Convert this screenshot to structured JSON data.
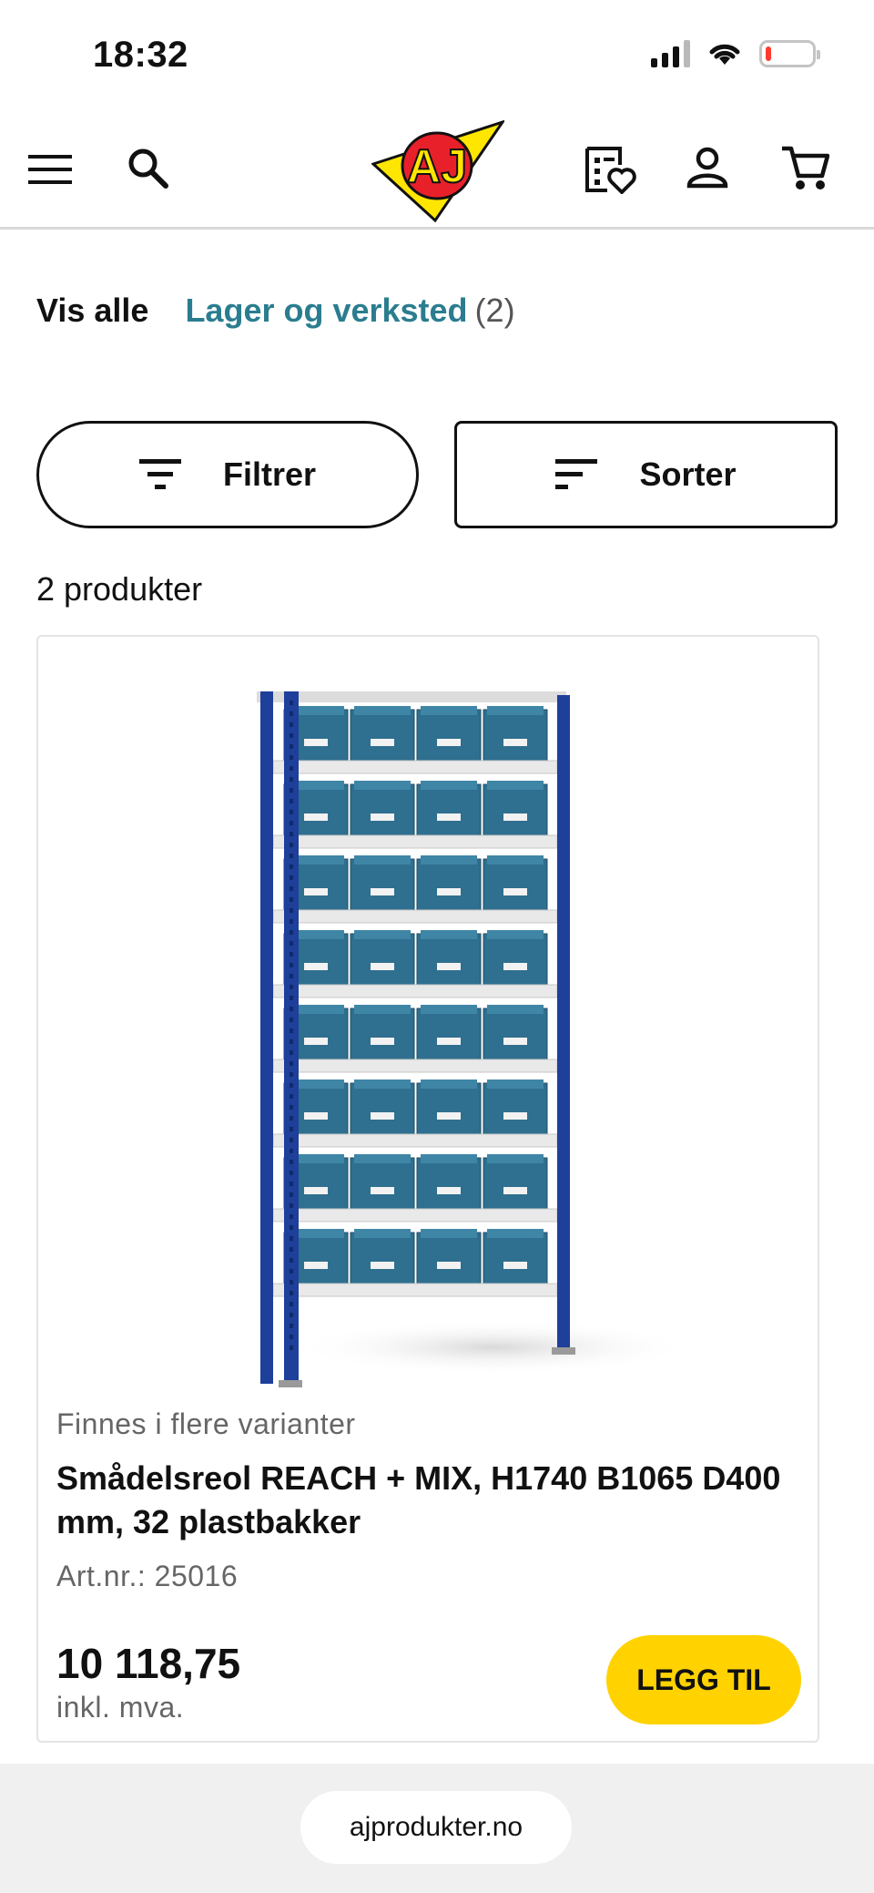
{
  "status_bar": {
    "time": "18:32",
    "battery_level": 0.12
  },
  "header": {
    "menu_icon": "hamburger-icon",
    "search_icon": "search-icon",
    "logo_text": "AJ",
    "wishlist_icon": "wishlist-heart-icon",
    "account_icon": "user-icon",
    "cart_icon": "cart-icon",
    "colors": {
      "logo_yellow": "#ffe600",
      "logo_red": "#e8202a"
    }
  },
  "breadcrumb": {
    "all_label": "Vis alle",
    "category_label": "Lager og verksted",
    "category_count": "(2)"
  },
  "toolbar": {
    "filter_label": "Filtrer",
    "sort_label": "Sorter"
  },
  "results": {
    "count_text": "2 produkter"
  },
  "product": {
    "variant_note": "Finnes i flere varianter",
    "title": "Smådelsreol REACH + MIX, H1740 B1065 D400 mm, 32 plastbakker",
    "article_number": "Art.nr.: 25016",
    "price": "10 118,75",
    "vat_note": "inkl. mva.",
    "add_button_label": "LEGG TIL"
  },
  "browser": {
    "url": "ajprodukter.no"
  },
  "colors": {
    "accent_teal": "#2a7d8f",
    "cta_yellow": "#ffd200",
    "shelf_blue": "#1e3f9a",
    "bin_teal": "#2f6f8f"
  }
}
